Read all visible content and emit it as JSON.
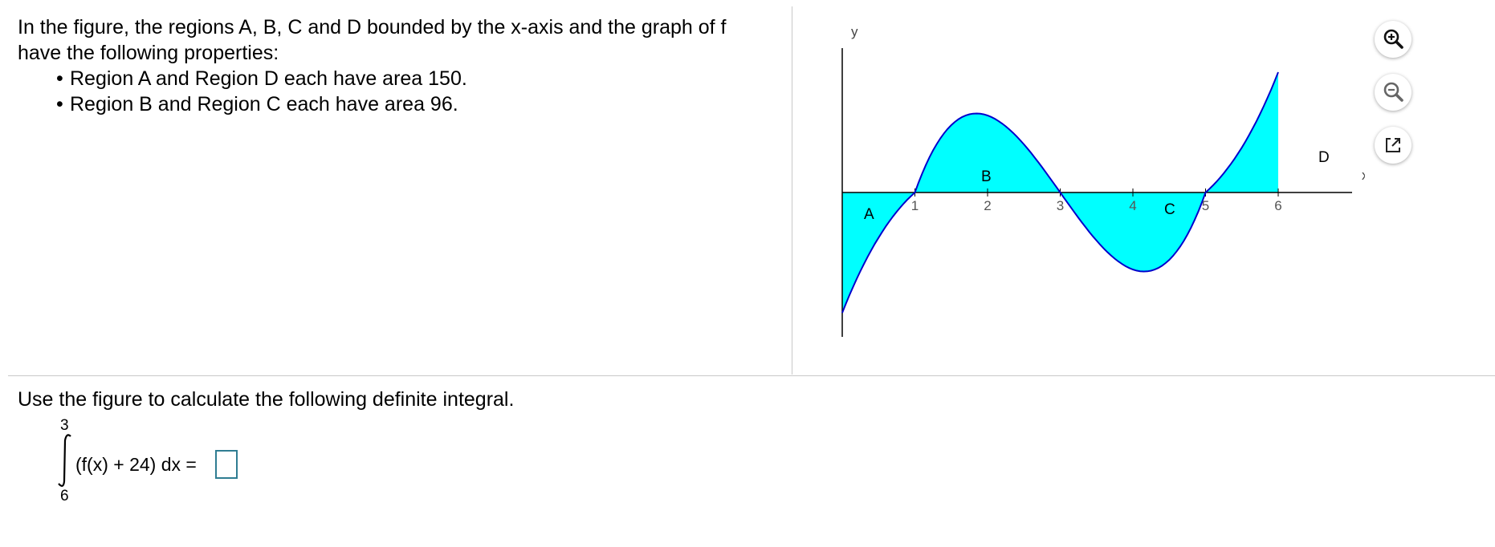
{
  "question": {
    "intro_line1": "In the figure, the regions A, B, C and D bounded by the x-axis and the graph of f",
    "intro_line2": "have the following properties:",
    "bullets": [
      "Region A and Region D each have area 150.",
      "Region B and Region C each have area 96."
    ]
  },
  "graph": {
    "y_axis_label": "y",
    "x_axis_label": "x",
    "x_ticks": [
      "1",
      "2",
      "3",
      "4",
      "5",
      "6"
    ],
    "region_labels": [
      "A",
      "B",
      "C",
      "D"
    ],
    "fill_color": "#00ffff",
    "curve_color": "#0000cc"
  },
  "chart_data": {
    "type": "area",
    "x_roots": [
      1,
      3,
      5
    ],
    "regions": [
      {
        "label": "A",
        "x_range": [
          0,
          1
        ],
        "area": 150
      },
      {
        "label": "B",
        "x_range": [
          1,
          3
        ],
        "area": 96
      },
      {
        "label": "C",
        "x_range": [
          3,
          5
        ],
        "area": 96
      },
      {
        "label": "D",
        "x_range": [
          5,
          6
        ],
        "area": 150
      }
    ],
    "xlim": [
      0,
      6.2
    ],
    "xlabel": "x",
    "ylabel": "y",
    "grid": false
  },
  "toolbar": {
    "zoom_in_icon": "zoom-in-icon",
    "zoom_out_icon": "zoom-out-icon",
    "popout_icon": "popout-icon"
  },
  "problem": {
    "instruction": "Use the figure to calculate the following definite integral.",
    "upper_limit": "3",
    "lower_limit": "6",
    "integrand": "(f(x) + 24) dx =",
    "answer_value": ""
  }
}
